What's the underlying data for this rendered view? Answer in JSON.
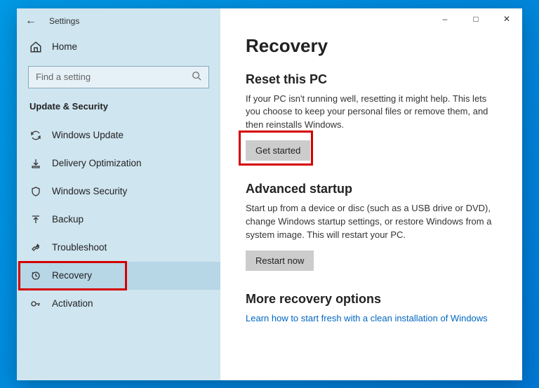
{
  "app": {
    "title": "Settings"
  },
  "home": {
    "label": "Home"
  },
  "search": {
    "placeholder": "Find a setting"
  },
  "category": "Update & Security",
  "nav": [
    {
      "label": "Windows Update"
    },
    {
      "label": "Delivery Optimization"
    },
    {
      "label": "Windows Security"
    },
    {
      "label": "Backup"
    },
    {
      "label": "Troubleshoot"
    },
    {
      "label": "Recovery"
    },
    {
      "label": "Activation"
    }
  ],
  "page": {
    "title": "Recovery",
    "reset": {
      "heading": "Reset this PC",
      "desc": "If your PC isn't running well, resetting it might help. This lets you choose to keep your personal files or remove them, and then reinstalls Windows.",
      "button": "Get started"
    },
    "advanced": {
      "heading": "Advanced startup",
      "desc": "Start up from a device or disc (such as a USB drive or DVD), change Windows startup settings, or restore Windows from a system image. This will restart your PC.",
      "button": "Restart now"
    },
    "more": {
      "heading": "More recovery options",
      "link": "Learn how to start fresh with a clean installation of Windows"
    }
  }
}
